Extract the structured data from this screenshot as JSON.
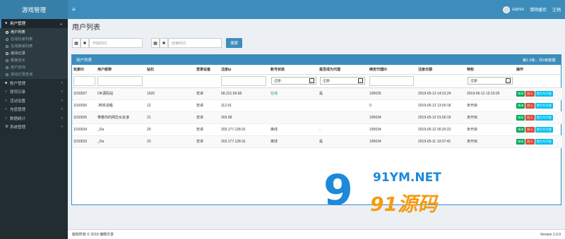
{
  "app": {
    "logo": "游戏管理"
  },
  "topbar": {
    "menu_icon": "≡",
    "user": "Admin",
    "clear_cache": "清除缓存",
    "logout": "注销"
  },
  "sidebar": {
    "groups": [
      {
        "label": "用户管理",
        "icon": "users-icon",
        "active": true,
        "items": [
          {
            "label": "用户列表",
            "state": "current"
          },
          {
            "label": "在线玩家列表",
            "state": ""
          },
          {
            "label": "在线牌桌列表",
            "state": ""
          },
          {
            "label": "房间记录",
            "state": "section"
          },
          {
            "label": "额度流水",
            "state": ""
          },
          {
            "label": "用户查询",
            "state": ""
          },
          {
            "label": "游戏记录查询",
            "state": ""
          }
        ]
      },
      {
        "label": "账户管理",
        "icon": "account-icon"
      },
      {
        "label": "提现记录",
        "icon": "withdraw-icon"
      },
      {
        "label": "活动设置",
        "icon": "activity-icon"
      },
      {
        "label": "充值管理",
        "icon": "recharge-icon"
      },
      {
        "label": "数据统计",
        "icon": "stats-icon"
      },
      {
        "label": "系统管理",
        "icon": "gear-icon"
      }
    ]
  },
  "page": {
    "title": "用户列表"
  },
  "filters": {
    "start_placeholder": "开始时间",
    "end_placeholder": "结束时间",
    "search_label": "搜索"
  },
  "table": {
    "header_title": "用户列表",
    "count_text": "第1-5条，共5条数据.",
    "columns": [
      "玩家ID",
      "用户昵称",
      "钻石",
      "登录设备",
      "注册ip",
      "账号状态",
      "是否成为代理",
      "绑定代理ID",
      "注册日期",
      "特权",
      "操作"
    ],
    "status_select": "-全部-",
    "agent_select": "-全部-",
    "privilege_select": "-全部-",
    "rows": [
      {
        "id": "1150037",
        "nick": "OK源码站",
        "diamond": "1920",
        "device": "安卓",
        "ip": "58.221.59.68",
        "status": "在线",
        "agent": "是",
        "bind": "100035",
        "reg": "2019-05-13 14:31:24",
        "priv": "2019-06-12 15:10:25",
        "status_online": true
      },
      {
        "id": "1150036",
        "nick": "-阿姣浅唱",
        "diamond": "12",
        "device": "安卓",
        "ip": "112.91",
        "status": "",
        "agent": "",
        "bind": "0",
        "reg": "2019-05-12 13:00:18",
        "priv": "未开启",
        "status_online": false
      },
      {
        "id": "1150035",
        "nick": "带着你的网恋女友滚",
        "diamond": "21",
        "device": "安卓",
        "ip": "203.58",
        "status": "",
        "agent": "",
        "bind": "100034",
        "reg": "2019-05-12 01:00:19",
        "priv": "未开启",
        "status_online": false
      },
      {
        "id": "1150034",
        "nick": "_Da",
        "diamond": "20",
        "device": "安卓",
        "ip": "203.177.128.91",
        "status": "离线",
        "agent": "..",
        "bind": "100034",
        "reg": "2019-05-12 00:25:22",
        "priv": "未开启",
        "status_online": false
      },
      {
        "id": "1150033",
        "nick": "_Da",
        "diamond": "23",
        "device": "安卓",
        "ip": "203.177.128.91",
        "status": "离线",
        "agent": "是",
        "bind": "100034",
        "reg": "2019-05-11 19:37:42",
        "priv": "未开启",
        "status_online": false
      }
    ],
    "actions": {
      "edit": "修改",
      "block": "封入",
      "promote": "提升为代理"
    }
  },
  "footer": {
    "copyright": "版权所有 © 2019 瑞辉乐享",
    "version": "Version 1.0.0"
  },
  "watermark": {
    "num": "9",
    "net": "91YM.NET",
    "cn": "91源码"
  },
  "colors": {
    "primary": "#3c8dbc",
    "sidebar": "#222d32",
    "success": "#00a65a",
    "danger": "#dd4b39",
    "info": "#00c0ef"
  }
}
